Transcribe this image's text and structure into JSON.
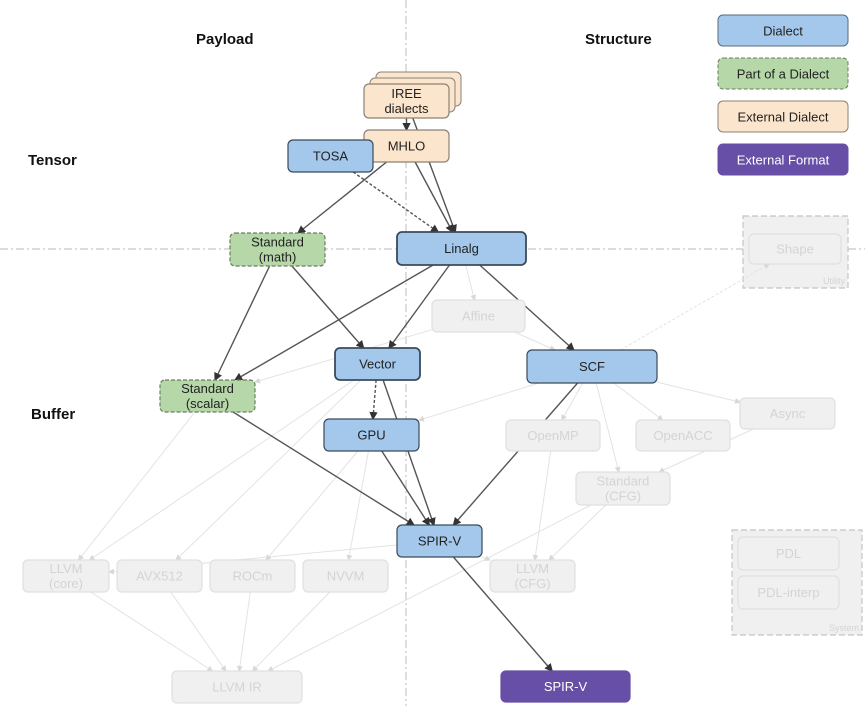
{
  "axes": {
    "payload": "Payload",
    "structure": "Structure",
    "tensor": "Tensor",
    "buffer": "Buffer"
  },
  "legend": [
    {
      "label": "Dialect",
      "style": "dialect"
    },
    {
      "label": "Part of a Dialect",
      "style": "part"
    },
    {
      "label": "External Dialect",
      "style": "external"
    },
    {
      "label": "External Format",
      "style": "format"
    }
  ],
  "groups": {
    "utility": "Utility",
    "system": "System"
  },
  "colors": {
    "dialect_fill": "#a4c8ec",
    "dialect_stroke": "#3b4a5a",
    "part_fill": "#b6d7a8",
    "part_stroke": "#6a7f60",
    "external_fill": "#fce5cd",
    "external_stroke": "#8a8176",
    "format_fill": "#674ea7",
    "format_text": "#ffffff",
    "faded_fill": "#f0f0f0",
    "faded_stroke": "#e0e0e0",
    "faded_text": "#d4d4d4",
    "edge_dark": "#555555",
    "edge_faded": "#e3e3e3"
  },
  "nodes": [
    {
      "id": "iree",
      "lines": [
        "IREE",
        "dialects"
      ],
      "style": "external",
      "stacked": true
    },
    {
      "id": "mhlo",
      "lines": [
        "MHLO"
      ],
      "style": "external"
    },
    {
      "id": "tosa",
      "lines": [
        "TOSA"
      ],
      "style": "dialect"
    },
    {
      "id": "std_math",
      "lines": [
        "Standard",
        "(math)"
      ],
      "style": "part"
    },
    {
      "id": "linalg",
      "lines": [
        "Linalg"
      ],
      "style": "dialect",
      "emphasis": true
    },
    {
      "id": "affine",
      "lines": [
        "Affine"
      ],
      "style": "faded"
    },
    {
      "id": "vector",
      "lines": [
        "Vector"
      ],
      "style": "dialect",
      "emphasis": true
    },
    {
      "id": "scf",
      "lines": [
        "SCF"
      ],
      "style": "dialect"
    },
    {
      "id": "std_scalar",
      "lines": [
        "Standard",
        "(scalar)"
      ],
      "style": "part"
    },
    {
      "id": "gpu",
      "lines": [
        "GPU"
      ],
      "style": "dialect"
    },
    {
      "id": "openmp",
      "lines": [
        "OpenMP"
      ],
      "style": "faded"
    },
    {
      "id": "openacc",
      "lines": [
        "OpenACC"
      ],
      "style": "faded"
    },
    {
      "id": "async",
      "lines": [
        "Async"
      ],
      "style": "faded"
    },
    {
      "id": "std_cfg",
      "lines": [
        "Standard",
        "(CFG)"
      ],
      "style": "faded"
    },
    {
      "id": "spirv",
      "lines": [
        "SPIR-V"
      ],
      "style": "dialect"
    },
    {
      "id": "llvm_core",
      "lines": [
        "LLVM",
        "(core)"
      ],
      "style": "faded"
    },
    {
      "id": "avx512",
      "lines": [
        "AVX512"
      ],
      "style": "faded"
    },
    {
      "id": "rocm",
      "lines": [
        "ROCm"
      ],
      "style": "faded"
    },
    {
      "id": "nvvm",
      "lines": [
        "NVVM"
      ],
      "style": "faded"
    },
    {
      "id": "llvm_cfg",
      "lines": [
        "LLVM",
        "(CFG)"
      ],
      "style": "faded"
    },
    {
      "id": "shape",
      "lines": [
        "Shape"
      ],
      "style": "faded"
    },
    {
      "id": "pdl",
      "lines": [
        "PDL"
      ],
      "style": "faded"
    },
    {
      "id": "pdl_interp",
      "lines": [
        "PDL-interp"
      ],
      "style": "faded"
    },
    {
      "id": "llvm_ir",
      "lines": [
        "LLVM IR"
      ],
      "style": "faded"
    },
    {
      "id": "spirv_format",
      "lines": [
        "SPIR-V"
      ],
      "style": "format"
    }
  ],
  "edges": [
    {
      "from": "iree",
      "to": "mhlo",
      "kind": "dark"
    },
    {
      "from": "iree",
      "to": "linalg",
      "kind": "dark"
    },
    {
      "from": "mhlo",
      "to": "linalg",
      "kind": "dark"
    },
    {
      "from": "mhlo",
      "to": "std_math",
      "kind": "dark"
    },
    {
      "from": "tosa",
      "to": "linalg",
      "kind": "dark-dashed"
    },
    {
      "from": "std_math",
      "to": "std_scalar",
      "kind": "dark"
    },
    {
      "from": "std_math",
      "to": "vector",
      "kind": "dark"
    },
    {
      "from": "linalg",
      "to": "vector",
      "kind": "dark"
    },
    {
      "from": "linalg",
      "to": "std_scalar",
      "kind": "dark"
    },
    {
      "from": "linalg",
      "to": "scf",
      "kind": "dark"
    },
    {
      "from": "linalg",
      "to": "affine",
      "kind": "faded"
    },
    {
      "from": "vector",
      "to": "gpu",
      "kind": "dark-dashed"
    },
    {
      "from": "vector",
      "to": "spirv",
      "kind": "dark"
    },
    {
      "from": "scf",
      "to": "spirv",
      "kind": "dark"
    },
    {
      "from": "gpu",
      "to": "spirv",
      "kind": "dark"
    },
    {
      "from": "std_scalar",
      "to": "spirv",
      "kind": "dark"
    },
    {
      "from": "spirv",
      "to": "spirv_format",
      "kind": "dark"
    },
    {
      "from": "affine",
      "to": "scf",
      "kind": "faded"
    },
    {
      "from": "affine",
      "to": "std_scalar",
      "kind": "faded"
    },
    {
      "from": "scf",
      "to": "openmp",
      "kind": "faded"
    },
    {
      "from": "scf",
      "to": "openacc",
      "kind": "faded"
    },
    {
      "from": "scf",
      "to": "async",
      "kind": "faded"
    },
    {
      "from": "scf",
      "to": "std_cfg",
      "kind": "faded"
    },
    {
      "from": "scf",
      "to": "gpu",
      "kind": "faded"
    },
    {
      "from": "scf",
      "to": "shape",
      "kind": "faded-dashed"
    },
    {
      "from": "async",
      "to": "std_cfg",
      "kind": "faded"
    },
    {
      "from": "openmp",
      "to": "llvm_cfg",
      "kind": "faded"
    },
    {
      "from": "std_cfg",
      "to": "llvm_cfg",
      "kind": "faded"
    },
    {
      "from": "std_cfg",
      "to": "llvm_ir",
      "kind": "faded"
    },
    {
      "from": "spirv",
      "to": "llvm_cfg",
      "kind": "faded"
    },
    {
      "from": "spirv",
      "to": "llvm_core",
      "kind": "faded"
    },
    {
      "from": "std_scalar",
      "to": "llvm_core",
      "kind": "faded"
    },
    {
      "from": "vector",
      "to": "llvm_core",
      "kind": "faded"
    },
    {
      "from": "vector",
      "to": "avx512",
      "kind": "faded"
    },
    {
      "from": "gpu",
      "to": "rocm",
      "kind": "faded"
    },
    {
      "from": "gpu",
      "to": "nvvm",
      "kind": "faded"
    },
    {
      "from": "llvm_core",
      "to": "llvm_ir",
      "kind": "faded"
    },
    {
      "from": "avx512",
      "to": "llvm_ir",
      "kind": "faded"
    },
    {
      "from": "rocm",
      "to": "llvm_ir",
      "kind": "faded"
    },
    {
      "from": "nvvm",
      "to": "llvm_ir",
      "kind": "faded"
    }
  ]
}
